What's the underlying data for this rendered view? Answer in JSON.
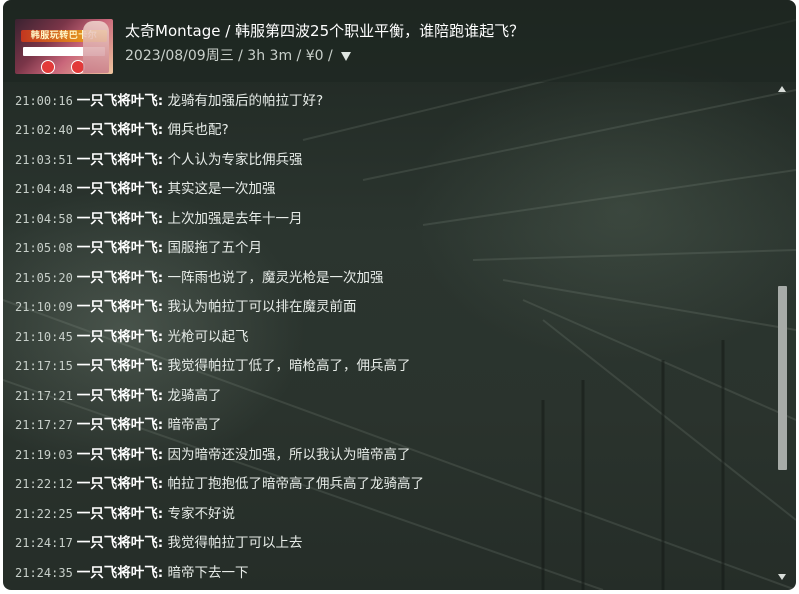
{
  "header": {
    "thumbnail_caption": "韩服玩转巴卡尔",
    "title": "太奇Montage / 韩服第四波25个职业平衡，谁陪跑谁起飞？",
    "meta": "2023/08/09周三 / 3h 3m / ¥0 /"
  },
  "messages": [
    {
      "time": "21:00:16",
      "user": "一只飞将叶飞:",
      "text": "龙骑有加强后的帕拉丁好?"
    },
    {
      "time": "21:02:40",
      "user": "一只飞将叶飞:",
      "text": "佣兵也配?"
    },
    {
      "time": "21:03:51",
      "user": "一只飞将叶飞:",
      "text": "个人认为专家比佣兵强"
    },
    {
      "time": "21:04:48",
      "user": "一只飞将叶飞:",
      "text": "其实这是一次加强"
    },
    {
      "time": "21:04:58",
      "user": "一只飞将叶飞:",
      "text": "上次加强是去年十一月"
    },
    {
      "time": "21:05:08",
      "user": "一只飞将叶飞:",
      "text": "国服拖了五个月"
    },
    {
      "time": "21:05:20",
      "user": "一只飞将叶飞:",
      "text": "一阵雨也说了，魔灵光枪是一次加强"
    },
    {
      "time": "21:10:09",
      "user": "一只飞将叶飞:",
      "text": "我认为帕拉丁可以排在魔灵前面"
    },
    {
      "time": "21:10:45",
      "user": "一只飞将叶飞:",
      "text": "光枪可以起飞"
    },
    {
      "time": "21:17:15",
      "user": "一只飞将叶飞:",
      "text": "我觉得帕拉丁低了，暗枪高了，佣兵高了"
    },
    {
      "time": "21:17:21",
      "user": "一只飞将叶飞:",
      "text": "龙骑高了"
    },
    {
      "time": "21:17:27",
      "user": "一只飞将叶飞:",
      "text": "暗帝高了"
    },
    {
      "time": "21:19:03",
      "user": "一只飞将叶飞:",
      "text": "因为暗帝还没加强，所以我认为暗帝高了"
    },
    {
      "time": "21:22:12",
      "user": "一只飞将叶飞:",
      "text": "帕拉丁抱抱低了暗帝高了佣兵高了龙骑高了"
    },
    {
      "time": "21:22:25",
      "user": "一只飞将叶飞:",
      "text": "专家不好说"
    },
    {
      "time": "21:24:17",
      "user": "一只飞将叶飞:",
      "text": "我觉得帕拉丁可以上去"
    },
    {
      "time": "21:24:35",
      "user": "一只飞将叶飞:",
      "text": "暗帝下去一下"
    }
  ],
  "scroll": {
    "position_fraction": 0.4,
    "visible_fraction": 0.39
  },
  "icons": {
    "filter": "filter-funnel-icon",
    "scroll_up": "chevron-up-icon",
    "scroll_down": "chevron-down-icon"
  },
  "colors": {
    "background": "#2a332d",
    "text": "#e7ece8",
    "username": "#ffffff",
    "scroll_thumb": "#a7aba8"
  }
}
